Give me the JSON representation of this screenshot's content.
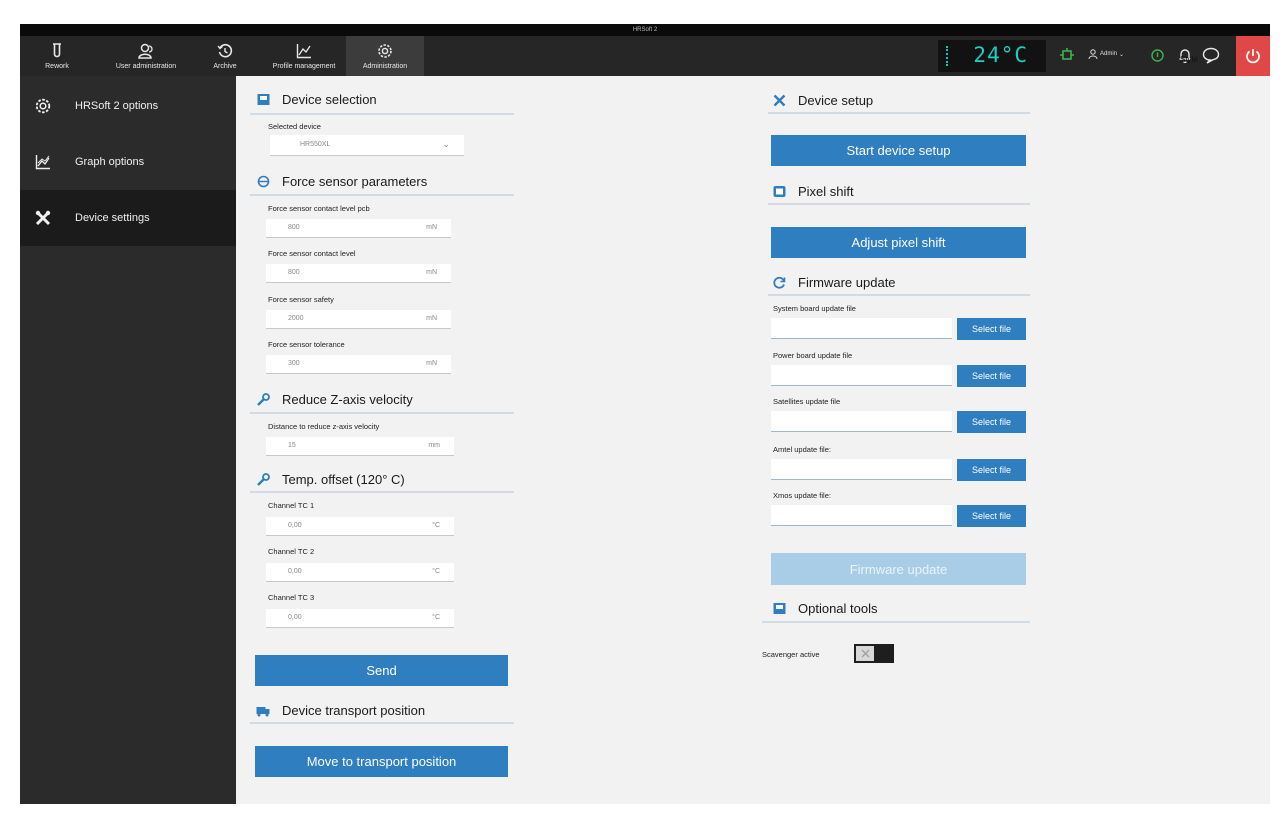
{
  "window": {
    "title": "HRSoft 2"
  },
  "topnav": {
    "items": [
      {
        "label": "Rework",
        "icon": "tube-icon"
      },
      {
        "label": "User administration",
        "icon": "users-icon"
      },
      {
        "label": "Archive",
        "icon": "history-icon"
      },
      {
        "label": "Profile management",
        "icon": "graph-icon"
      },
      {
        "label": "Administration",
        "icon": "gear-icon"
      }
    ],
    "temperature": "24°C",
    "user": "Admin",
    "style_label": "Style",
    "accent_temperature": "#19d0c2",
    "power_color": "#e04848"
  },
  "sidebar": {
    "items": [
      {
        "label": "HRSoft 2 options",
        "icon": "gear-icon"
      },
      {
        "label": "Graph options",
        "icon": "graph-icon"
      },
      {
        "label": "Device settings",
        "icon": "tools-icon"
      }
    ]
  },
  "left": {
    "device_selection": {
      "title": "Device selection",
      "selected_label": "Selected device",
      "selected_value": "HR550XL"
    },
    "force": {
      "title": "Force sensor parameters",
      "fields": [
        {
          "label": "Force sensor contact level pcb",
          "value": "800",
          "unit": "mN"
        },
        {
          "label": "Force sensor contact level",
          "value": "800",
          "unit": "mN"
        },
        {
          "label": "Force sensor safety",
          "value": "2000",
          "unit": "mN"
        },
        {
          "label": "Force sensor tolerance",
          "value": "300",
          "unit": "mN"
        }
      ]
    },
    "reduce_z": {
      "title": "Reduce Z-axis velocity",
      "label": "Distance to reduce z-axis velocity",
      "value": "15",
      "unit": "mm"
    },
    "temp_offset": {
      "title": "Temp. offset (120° C)",
      "fields": [
        {
          "label": "Channel TC 1",
          "value": "0,00",
          "unit": "°C"
        },
        {
          "label": "Channel TC 2",
          "value": "0,00",
          "unit": "°C"
        },
        {
          "label": "Channel TC 3",
          "value": "0,00",
          "unit": "°C"
        }
      ]
    },
    "send_label": "Send",
    "transport": {
      "title": "Device transport position",
      "button": "Move to transport position"
    }
  },
  "right": {
    "setup": {
      "title": "Device setup",
      "button": "Start device setup"
    },
    "pixel": {
      "title": "Pixel shift",
      "button": "Adjust pixel shift"
    },
    "firmware": {
      "title": "Firmware update",
      "files": [
        {
          "label": "System board update file",
          "button": "Select file"
        },
        {
          "label": "Power board update file",
          "button": "Select file"
        },
        {
          "label": "Satellites update file",
          "button": "Select file"
        },
        {
          "label": "Amtel update file:",
          "button": "Select file"
        },
        {
          "label": "Xmos update file:",
          "button": "Select file"
        }
      ],
      "update_button": "Firmware update"
    },
    "optional": {
      "title": "Optional tools",
      "scavenger_label": "Scavenger active",
      "scavenger_on": false
    }
  }
}
